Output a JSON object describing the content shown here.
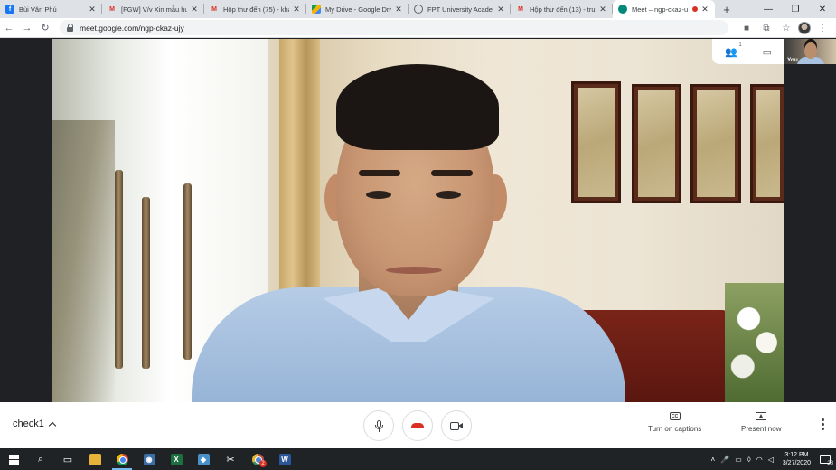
{
  "browser": {
    "tabs": [
      {
        "title": "Bùi Văn Phú",
        "favicon": "facebook-icon",
        "color": "#1877f2"
      },
      {
        "title": "[FGW] V/v Xin mẫu hư",
        "favicon": "gmail-icon",
        "color": "#d93025"
      },
      {
        "title": "Hộp thư đến (75) - kha",
        "favicon": "gmail-icon",
        "color": "#d93025"
      },
      {
        "title": "My Drive - Google Driv",
        "favicon": "drive-icon",
        "color": "#0f9d58"
      },
      {
        "title": "FPT University Academ",
        "favicon": "globe-icon",
        "color": "#5f6368"
      },
      {
        "title": "Hộp thư đến (13) - tru",
        "favicon": "gmail-icon",
        "color": "#d93025"
      },
      {
        "title": "Meet – ngp-ckaz-u",
        "favicon": "meet-icon",
        "color": "#00897b",
        "active": true,
        "recording": true
      }
    ],
    "new_tab_label": "+",
    "url": "meet.google.com/ngp-ckaz-ujy"
  },
  "meet": {
    "participant_count": "1",
    "self_label": "You",
    "meeting_code": "check1",
    "captions_label": "Turn on captions",
    "present_label": "Present now"
  },
  "taskbar": {
    "time": "3:12 PM",
    "date": "3/27/2020",
    "chrome_badge": "2",
    "notification_count": "28"
  },
  "colors": {
    "hangup": "#d93025",
    "taskbar": "#1f2326",
    "meet_bg": "#202124"
  }
}
